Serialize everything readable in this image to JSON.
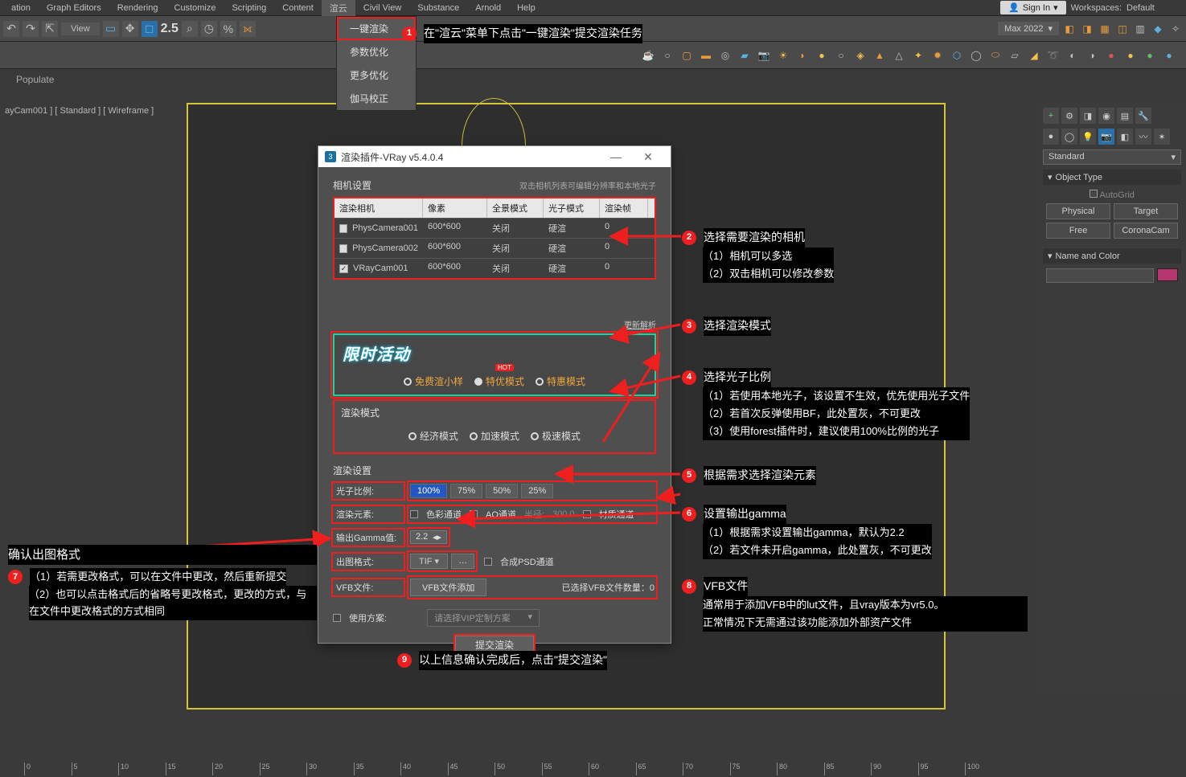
{
  "menubar": {
    "items": [
      "ation",
      "Graph Editors",
      "Rendering",
      "Customize",
      "Scripting",
      "Content",
      "渲云",
      "Civil View",
      "Substance",
      "Arnold",
      "Help"
    ],
    "open_index": 6,
    "signin": "Sign In",
    "workspaces_label": "Workspaces:",
    "workspaces_value": "Default"
  },
  "dropdown": {
    "items": [
      "一键渲染",
      "参数优化",
      "更多优化",
      "伽马校正"
    ]
  },
  "toolbar": {
    "view_label": "View",
    "scale_label": "2.5",
    "version": "Max 2022"
  },
  "viewport_label": "ayCam001 ] [ Standard ] [ Wireframe ]",
  "populate": "Populate",
  "dialog": {
    "title": "渲染插件-VRay v5.4.0.4",
    "camera_section": "相机设置",
    "camera_hint": "双击相机列表可编辑分辨率和本地光子",
    "headers": [
      "渲染相机",
      "像素",
      "全景模式",
      "光子模式",
      "渲染帧"
    ],
    "rows": [
      {
        "checked": false,
        "name": "PhysCamera001",
        "res": "600*600",
        "pano": "关闭",
        "photon": "硬渲",
        "frames": "0"
      },
      {
        "checked": false,
        "name": "PhysCamera002",
        "res": "600*600",
        "pano": "关闭",
        "photon": "硬渲",
        "frames": "0"
      },
      {
        "checked": true,
        "name": "VRayCam001",
        "res": "600*600",
        "pano": "关闭",
        "photon": "硬渲",
        "frames": "0"
      }
    ],
    "refresh": "更新解析",
    "promo_title": "限时活动",
    "promo_modes": [
      "免费渲小样",
      "特优模式",
      "特惠模式"
    ],
    "hot_tag": "HOT",
    "render_mode_label": "渲染模式",
    "render_modes": [
      "经济模式",
      "加速模式",
      "极速模式"
    ],
    "render_settings_label": "渲染设置",
    "ratio_label": "光子比例:",
    "ratio_opts": [
      "100%",
      "75%",
      "50%",
      "25%"
    ],
    "elements_label": "渲染元素:",
    "elem_color": "色彩通道",
    "elem_ao": "AO通道",
    "radius_label": "半径:",
    "radius_val": "300.0",
    "elem_mat": "材质通道",
    "gamma_label": "输出Gamma值:",
    "gamma_val": "2.2",
    "fmt_label": "出图格式:",
    "fmt_val": "TIF",
    "fmt_dots": "…",
    "psd_label": "合成PSD通道",
    "vfb_label": "VFB文件:",
    "vfb_btn": "VFB文件添加",
    "vfb_count_label": "已选择VFB文件数量：",
    "vfb_count": "0",
    "scheme_chk": "使用方案:",
    "scheme_sel": "请选择VIP定制方案",
    "submit": "提交渲染"
  },
  "callouts": {
    "c1": "在\"渲云\"菜单下点击\"一键渲染\"提交渲染任务",
    "c2_title": "选择需要渲染的相机",
    "c2_a": "（1）相机可以多选",
    "c2_b": "（2）双击相机可以修改参数",
    "c3": "选择渲染模式",
    "c4_title": "选择光子比例",
    "c4_a": "（1）若使用本地光子，该设置不生效，优先使用光子文件",
    "c4_b": "（2）若首次反弹使用BF，此处置灰，不可更改",
    "c4_c": "（3）使用forest插件时，建议使用100%比例的光子",
    "c5": "根据需求选择渲染元素",
    "c6_title": "设置输出gamma",
    "c6_a": "（1）根据需求设置输出gamma，默认为2.2",
    "c6_b": "（2）若文件未开启gamma，此处置灰，不可更改",
    "c7_title": "确认出图格式",
    "c7_a": "（1）若需更改格式，可以在文件中更改，然后重新提交",
    "c7_b": "（2）也可以点击格式后的省略号更改格式，更改的方式，与在文件中更改格式的方式相同",
    "c8_title": "VFB文件",
    "c8_a": "通常用于添加VFB中的lut文件，且vray版本为vr5.0。",
    "c8_b": "正常情况下无需通过该功能添加外部资产文件",
    "c9": "以上信息确认完成后，点击\"提交渲染\""
  },
  "side": {
    "standard": "Standard",
    "object_type": "Object Type",
    "autogrid": "AutoGrid",
    "btns": [
      "Physical",
      "Target",
      "Free",
      "CoronaCam"
    ],
    "name_color": "Name and Color"
  },
  "ruler_ticks": [
    0,
    5,
    10,
    15,
    20,
    25,
    30,
    35,
    40,
    45,
    50,
    55,
    60,
    65,
    70,
    75,
    80,
    85,
    90,
    95,
    100
  ]
}
